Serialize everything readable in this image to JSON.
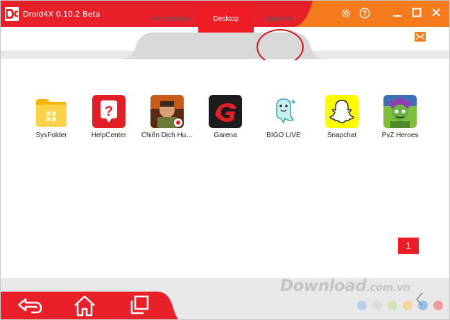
{
  "titlebar": {
    "title": "Droid4X 0.10.2 Beta",
    "icons": [
      "gear-icon",
      "help-icon",
      "minimize-icon",
      "maximize-icon",
      "close-icon"
    ],
    "colors": {
      "red": "#e8202a",
      "orange": "#f47c1f"
    }
  },
  "tabs": [
    {
      "label": "Recommand",
      "active": false
    },
    {
      "label": "Desktop",
      "active": true
    },
    {
      "label": "AppStore",
      "active": false,
      "annotated": true
    }
  ],
  "apps": [
    {
      "label": "SysFolder",
      "icon": "folder-icon"
    },
    {
      "label": "HelpCenter",
      "icon": "help-center-icon"
    },
    {
      "label": "Chiến Dịch Hu…",
      "icon": "game-icon"
    },
    {
      "label": "Garena",
      "icon": "garena-icon"
    },
    {
      "label": "BIGO LIVE",
      "icon": "bigo-live-icon"
    },
    {
      "label": "Snapchat",
      "icon": "snapchat-icon"
    },
    {
      "label": "PvZ Heroes",
      "icon": "pvz-heroes-icon"
    }
  ],
  "pager": {
    "current_page": "1"
  },
  "bottom_nav": [
    "back-icon",
    "home-icon",
    "recent-apps-icon"
  ],
  "watermark": {
    "text": "Download",
    "suffix": ".com.vn"
  },
  "accent_color": "#ee1c24"
}
